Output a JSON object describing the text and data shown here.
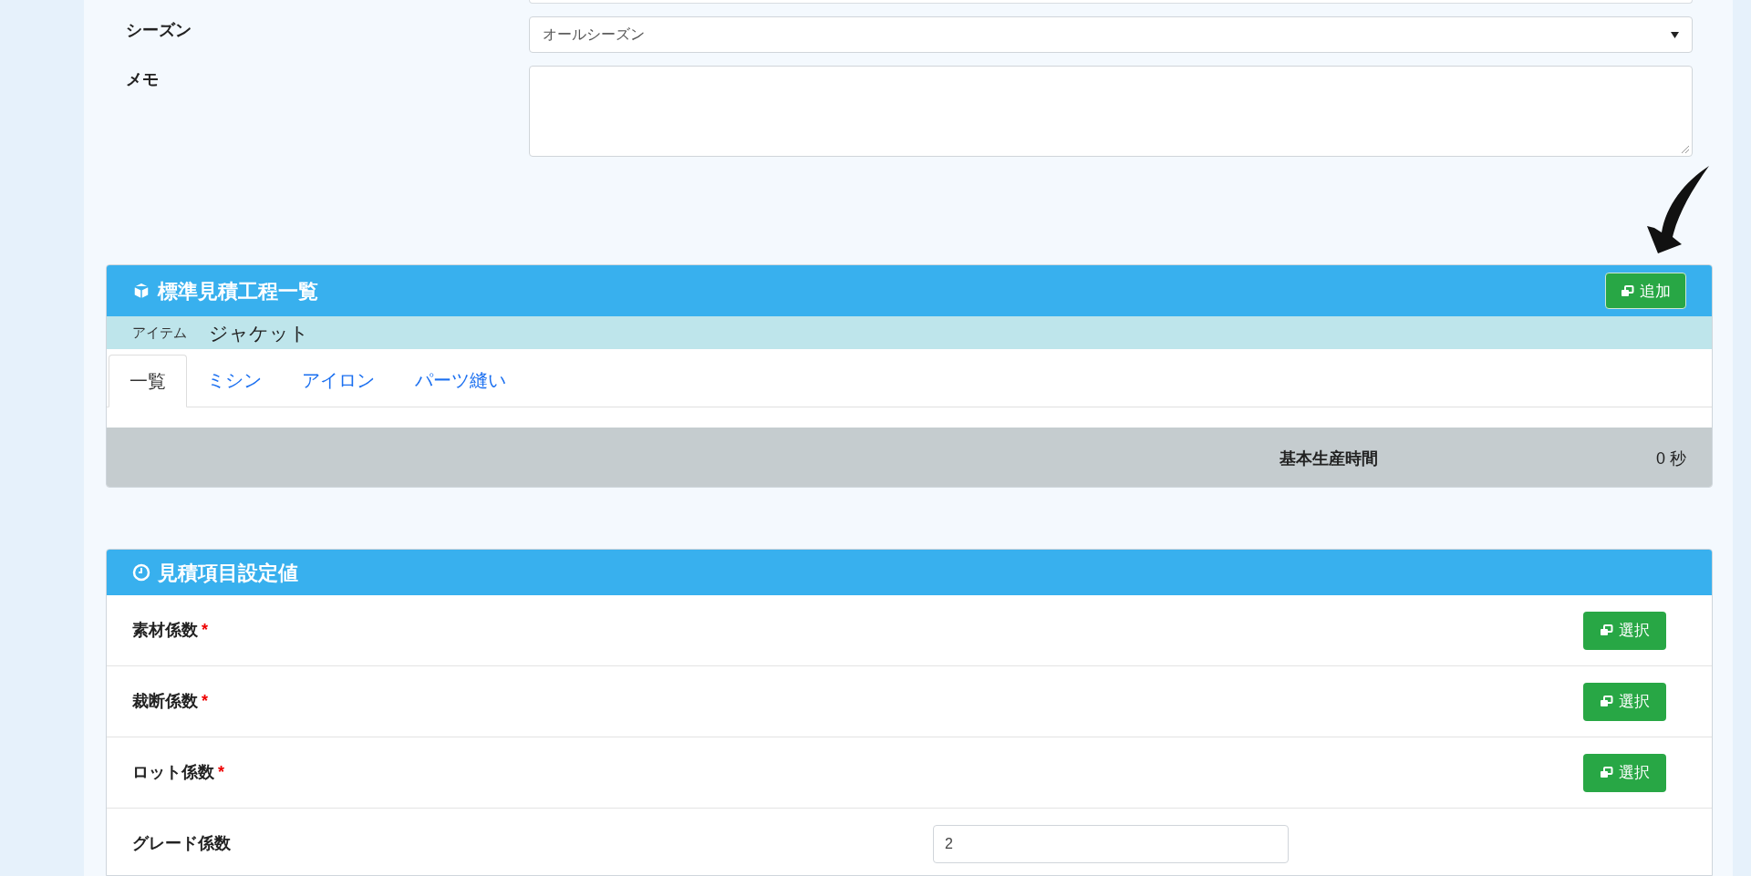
{
  "form": {
    "fields": [
      {
        "kind": "select",
        "label": "シーズン",
        "value": "オールシーズン"
      },
      {
        "kind": "textarea",
        "label": "メモ"
      }
    ]
  },
  "process_panel": {
    "title": "標準見積工程一覧",
    "add_button": "追加",
    "item_label": "アイテム",
    "item_value": "ジャケット",
    "tabs": [
      {
        "label": "一覧",
        "selected": true
      },
      {
        "label": "ミシン",
        "selected": false
      },
      {
        "label": "アイロン",
        "selected": false
      },
      {
        "label": "パーツ縫い",
        "selected": false
      }
    ],
    "footer_label": "基本生産時間",
    "footer_value": "0 秒"
  },
  "settings_panel": {
    "title": "見積項目設定値",
    "rows": [
      {
        "kind": "button",
        "label": "素材係数",
        "required_mark": "*",
        "button": "選択"
      },
      {
        "kind": "button",
        "label": "裁断係数",
        "required_mark": "*",
        "button": "選択"
      },
      {
        "kind": "button",
        "label": "ロット係数",
        "required_mark": "*",
        "button": "選択"
      },
      {
        "kind": "input",
        "label": "グレード係数",
        "value": "2"
      }
    ]
  }
}
